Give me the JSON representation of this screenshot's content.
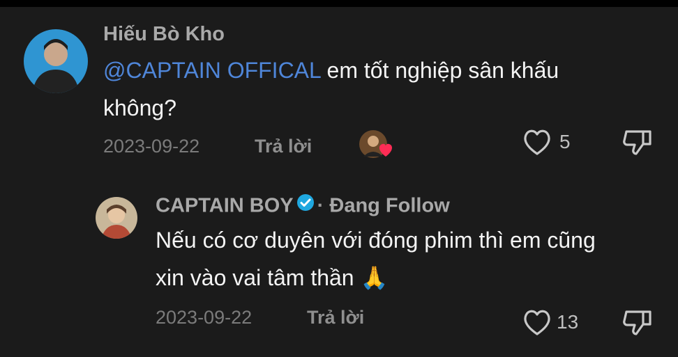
{
  "comment1": {
    "author": "Hiếu Bò Kho",
    "mention": "@CAPTAIN OFFICAL",
    "text_line1": " em tốt nghiệp sân khấu",
    "text_line2": "không?",
    "date": "2023-09-22",
    "reply_label": "Trả lời",
    "like_count": "5"
  },
  "comment2": {
    "author": "CAPTAIN BOY",
    "follow_sep": "·",
    "follow_status": "Đang Follow",
    "text_line1": "Nếu có cơ duyên với đóng phim thì em cũng",
    "text_line2": "xin vào vai tâm thần 🙏",
    "date": "2023-09-22",
    "reply_label": "Trả lời",
    "like_count": "13"
  },
  "colors": {
    "background": "#1b1b1b",
    "mention": "#4f86d9",
    "verified": "#1fa8e0",
    "creator_heart": "#fe2c55"
  }
}
